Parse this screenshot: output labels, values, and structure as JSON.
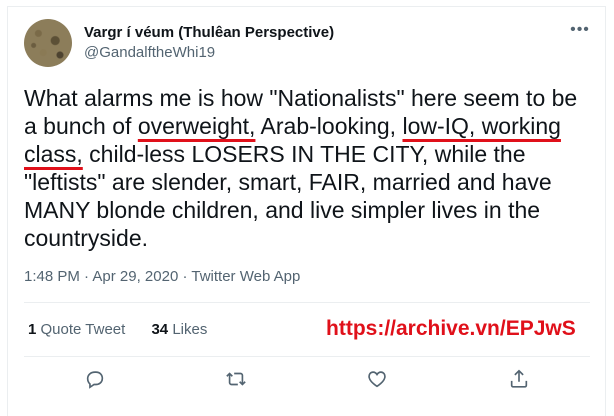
{
  "author": {
    "display_name": "Vargr í véum (Thulêan Perspective)",
    "handle": "@GandalftheWhi19"
  },
  "menu_icon": "more-horizontal-icon",
  "tweet": {
    "segments": [
      "What alarms me is how \"Nationalists\" here seem to be a bunch of ",
      "overweight,",
      " Arab-looking, ",
      "low-IQ, working class,",
      " child-less LOSERS IN THE CITY, while the \"leftists\" are slender, smart, FAIR, married and have MANY blonde children, and live simpler lives in the countryside."
    ],
    "underline_color": "#e0101a"
  },
  "meta": {
    "time": "1:48 PM",
    "date": "Apr 29, 2020",
    "source": "Twitter Web App",
    "separator": "·"
  },
  "stats": {
    "quote_count": "1",
    "quote_label": "Quote Tweet",
    "like_count": "34",
    "like_label": "Likes"
  },
  "annotation": {
    "text": "https://archive.vn/EPJwS",
    "color": "#e0101a"
  },
  "actions": [
    {
      "name": "reply",
      "icon": "reply-icon"
    },
    {
      "name": "retweet",
      "icon": "retweet-icon"
    },
    {
      "name": "like",
      "icon": "heart-icon"
    },
    {
      "name": "share",
      "icon": "share-icon"
    }
  ]
}
